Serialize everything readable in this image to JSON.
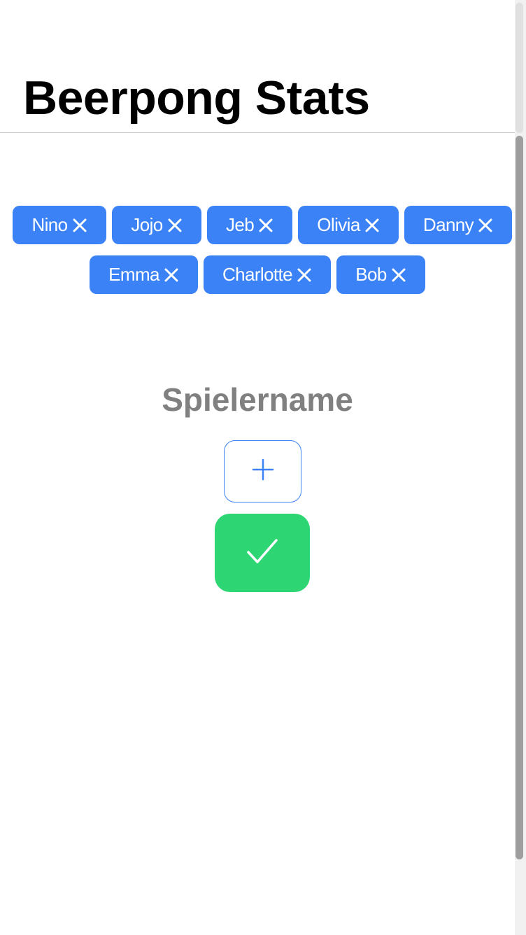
{
  "header": {
    "title": "Beerpong Stats"
  },
  "players": {
    "row1": [
      {
        "name": "Nino"
      },
      {
        "name": "Jojo"
      },
      {
        "name": "Jeb"
      },
      {
        "name": "Olivia"
      },
      {
        "name": "Danny"
      }
    ],
    "row2": [
      {
        "name": "Emma"
      },
      {
        "name": "Charlotte"
      },
      {
        "name": "Bob"
      }
    ],
    "remove_icon": "close-icon"
  },
  "form": {
    "name_label": "Spielername",
    "add_icon": "plus-icon",
    "confirm_icon": "checkmark-icon"
  },
  "colors": {
    "chip": "#3b82f6",
    "add_border": "#3b82f6",
    "confirm": "#2ed573",
    "label": "#808080"
  }
}
